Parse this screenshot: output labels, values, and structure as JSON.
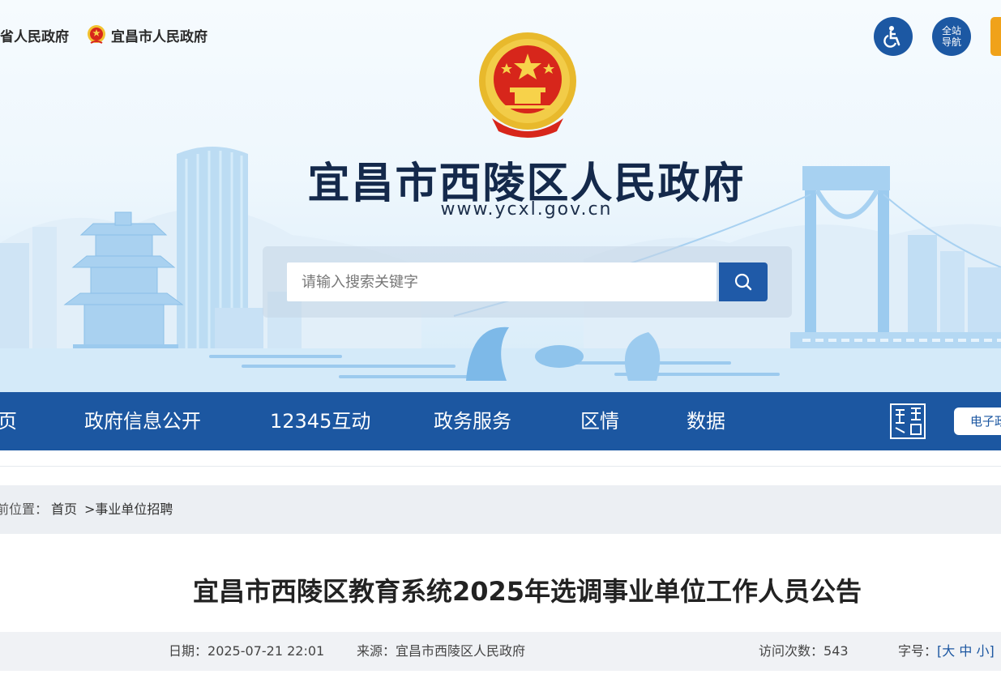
{
  "top_links": [
    "省人民政府",
    "宜昌市人民政府"
  ],
  "accessibility_label": "无障碍",
  "site_nav_label": [
    "全站",
    "导航"
  ],
  "site": {
    "title": "宜昌市西陵区人民政府",
    "url": "www.ycxl.gov.cn"
  },
  "search": {
    "placeholder": "请输入搜索关键字"
  },
  "nav": [
    "页",
    "政府信息公开",
    "12345互动",
    "政务服务",
    "区情",
    "数据"
  ],
  "ebook_label": "电子政",
  "breadcrumb": {
    "label": "前位置：",
    "home": "首页",
    "current": ">事业单位招聘"
  },
  "article": {
    "title": "宜昌市西陵区教育系统2025年选调事业单位工作人员公告",
    "date_label": "日期：",
    "date": "2025-07-21 22:01",
    "source_label": "来源：",
    "source": "宜昌市西陵区人民政府",
    "visits_label": "访问次数：",
    "visits": "543",
    "font_label": "字号：",
    "font_open": "[",
    "font_sizes": [
      "大",
      "中",
      "小"
    ],
    "font_close": "]"
  },
  "colors": {
    "nav_bg": "#1c57a1",
    "title_navy": "#14294b",
    "accent_orange": "#f0a21a",
    "breadcrumb_bg": "#eceff3"
  },
  "icons": [
    "national-emblem-icon",
    "accessibility-icon",
    "search-icon",
    "yichang-logo-icon"
  ]
}
